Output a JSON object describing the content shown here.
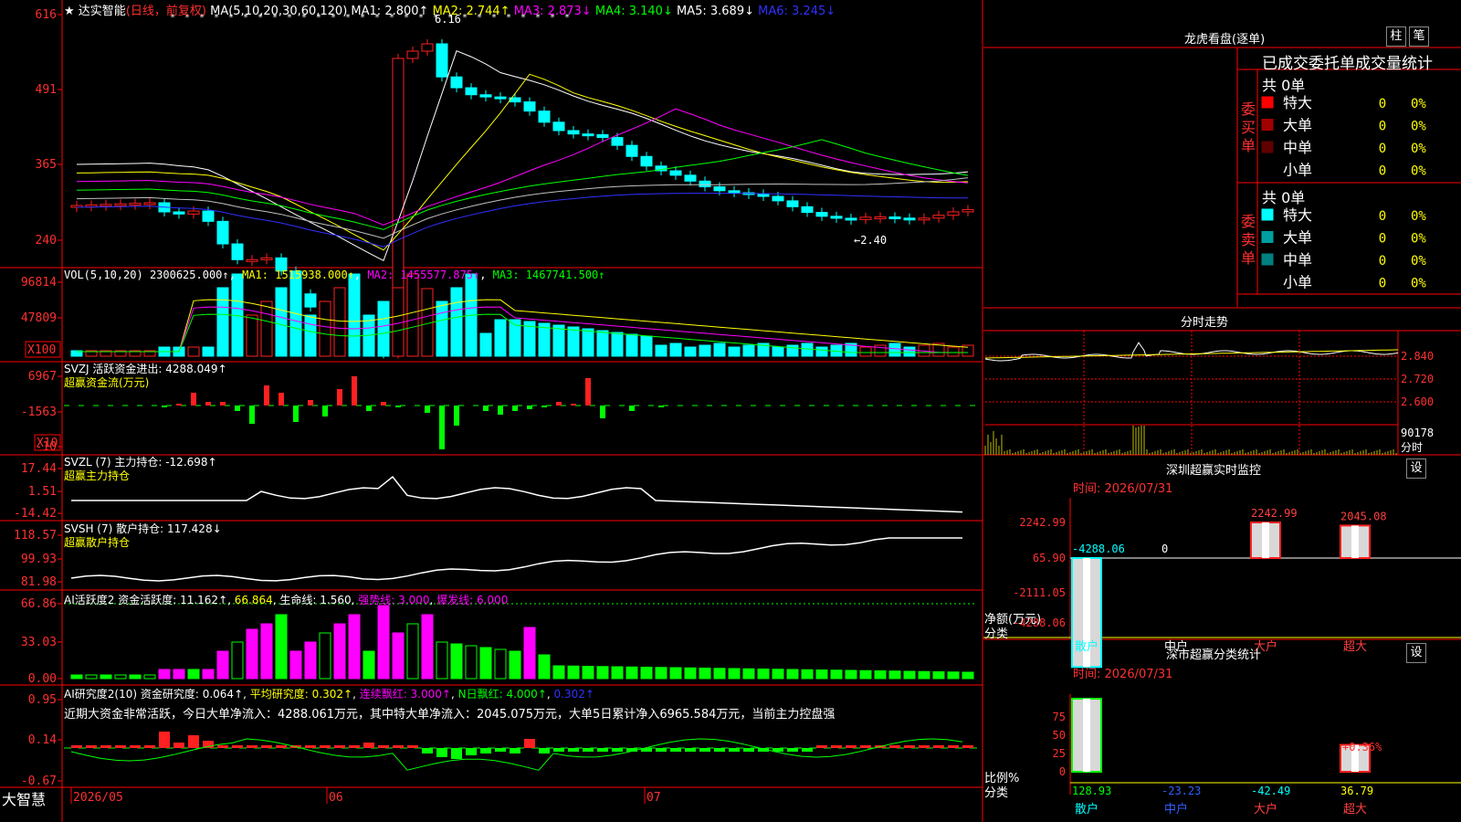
{
  "main_chart": {
    "stock_name": "达实智能",
    "period_label": "(日线，前复权)",
    "ma_label": "MA(5,10,20,30,60,120)",
    "ma_items": [
      {
        "label": "MA1: 2.800↑",
        "color": "#ffffff"
      },
      {
        "label": "MA2: 2.744↑",
        "color": "#ffff00"
      },
      {
        "label": "MA3: 2.873↓",
        "color": "#ff00ff"
      },
      {
        "label": "MA4: 3.140↓",
        "color": "#00ff00"
      },
      {
        "label": "MA5: 3.689↓",
        "color": "#ffffff"
      },
      {
        "label": "MA6: 3.245↓",
        "color": "#3030ff"
      }
    ],
    "y_ticks": [
      "616",
      "491",
      "365",
      "240"
    ],
    "high_label": "6.16",
    "low_label": "←2.40"
  },
  "volume": {
    "label": "VOL(5,10,20)",
    "value": "2300625.000↑",
    "ma1": "MA1: 1515938.000↑",
    "ma2": "MA2: 1455577.875↑",
    "ma3": "MA3: 1467741.500↑",
    "y_ticks": [
      "96814",
      "47809"
    ],
    "multiplier": "X100"
  },
  "svzj": {
    "label": "SVZJ  活跃资金进出: 4288.049↑",
    "subtitle": "超赢资金流(万元)",
    "y_ticks": [
      "6967",
      "-1563",
      "-10"
    ],
    "multiplier": "X10"
  },
  "svzl": {
    "label": "SVZL (7) 主力持仓: -12.698↑",
    "subtitle": "超赢主力持仓",
    "y_ticks": [
      "17.44",
      "1.51",
      "-14.42"
    ]
  },
  "svsh": {
    "label": "SVSH (7) 散户持仓: 117.428↓",
    "subtitle": "超赢散户持仓",
    "y_ticks": [
      "118.57",
      "99.93",
      "81.98"
    ]
  },
  "ai_activity": {
    "label": "AI活跃度2",
    "v1": "资金活跃度: 11.162↑",
    "v2": "66.864",
    "v3": "生命线: 1.560",
    "v4": "强势线: 3.000",
    "v5": "爆发线: 6.000",
    "y_ticks": [
      "66.86",
      "33.03",
      "0.00"
    ]
  },
  "ai_research": {
    "label": "AI研究度2(10)",
    "v1": "资金研究度: 0.064↑",
    "v2": "平均研究度: 0.302↑",
    "v3": "连续飘红: 3.000↑",
    "v4": "N日飘红: 4.000↑",
    "v5": "0.302↑",
    "summary": "近期大资金非常活跃，今日大单净流入：4288.061万元，其中特大单净流入：2045.075万元，大单5日累计净入6965.584万元，当前主力控盘强",
    "y_ticks": [
      "0.95",
      "0.14",
      "-0.67"
    ]
  },
  "date_axis": {
    "brand": "大智慧",
    "labels": [
      "2026/05",
      "06",
      "07"
    ]
  },
  "right_panel": {
    "dragon_title": "龙虎看盘(逐单)",
    "btn_column": "柱",
    "btn_pen": "笔",
    "order_stats_title": "已成交委托单成交量统计",
    "buy_label": "委买单",
    "sell_label": "委卖单",
    "buy_total": "共 0单",
    "sell_total": "共 0单",
    "buy_rows": [
      {
        "name": "特大",
        "count": "0",
        "pct": "0%",
        "color": "#ff0000"
      },
      {
        "name": "大单",
        "count": "0",
        "pct": "0%",
        "color": "#a00000"
      },
      {
        "name": "中单",
        "count": "0",
        "pct": "0%",
        "color": "#600000"
      },
      {
        "name": "小单",
        "count": "0",
        "pct": "0%",
        "color": "#000000"
      }
    ],
    "sell_rows": [
      {
        "name": "特大",
        "count": "0",
        "pct": "0%",
        "color": "#00ffff"
      },
      {
        "name": "大单",
        "count": "0",
        "pct": "0%",
        "color": "#00a0a0"
      },
      {
        "name": "中单",
        "count": "0",
        "pct": "0%",
        "color": "#008080"
      },
      {
        "name": "小单",
        "count": "0",
        "pct": "0%",
        "color": "#000000"
      }
    ],
    "intraday_title": "分时走势",
    "intraday_ticks": [
      "2.840",
      "2.720",
      "2.600"
    ],
    "intraday_vol": "90178",
    "intraday_label": "分时",
    "sz_monitor_title": "深圳超赢实时监控",
    "sz_monitor_time": "时间: 2026/07/31",
    "settings_label": "设",
    "monitor_y_ticks": [
      "2242.99",
      "65.90",
      "-2111.05",
      "-4288.06"
    ],
    "monitor_bars": [
      {
        "cat": "散户",
        "value": -4288.06,
        "label": "-4288.06",
        "label_color": "#00ffff",
        "cat_color": "#00ffff"
      },
      {
        "cat": "中户",
        "value": 0,
        "label": "0",
        "label_color": "#ffffff",
        "cat_color": "#ffffff"
      },
      {
        "cat": "大户",
        "value": 2242.99,
        "label": "2242.99",
        "label_color": "#ff4040",
        "cat_color": "#ff4040"
      },
      {
        "cat": "超大",
        "value": 2045.08,
        "label": "2045.08",
        "label_color": "#ff4040",
        "cat_color": "#ff4040"
      }
    ],
    "net_label": "净额(万元)",
    "cat_label": "分类",
    "class_title": "深市超赢分类统计",
    "class_time": "时间: 2026/07/31",
    "class_y_ticks": [
      "75",
      "50",
      "25",
      "0"
    ],
    "ratio_label": "比例%",
    "class_bars": [
      {
        "cat": "散户",
        "value": 128.93,
        "label": "128.93",
        "label_color": "#00ff00",
        "cat_color": "#00ffff"
      },
      {
        "cat": "中户",
        "value": -23.23,
        "label": "-23.23",
        "label_color": "#3060ff",
        "cat_color": "#3060ff"
      },
      {
        "cat": "大户",
        "value": -42.49,
        "label": "-42.49",
        "label_color": "#00ffff",
        "cat_color": "#ff4040"
      },
      {
        "cat": "超大",
        "value": 36.79,
        "label": "36.79",
        "label_color": "#ffff00",
        "cat_color": "#ff4040"
      }
    ],
    "class_extra_label": "+0.36%"
  },
  "colors": {
    "up": "#ff2020",
    "down": "#00ffff",
    "grid": "#ff0000",
    "axis_text": "#ff3030",
    "yellow": "#ffff00"
  }
}
